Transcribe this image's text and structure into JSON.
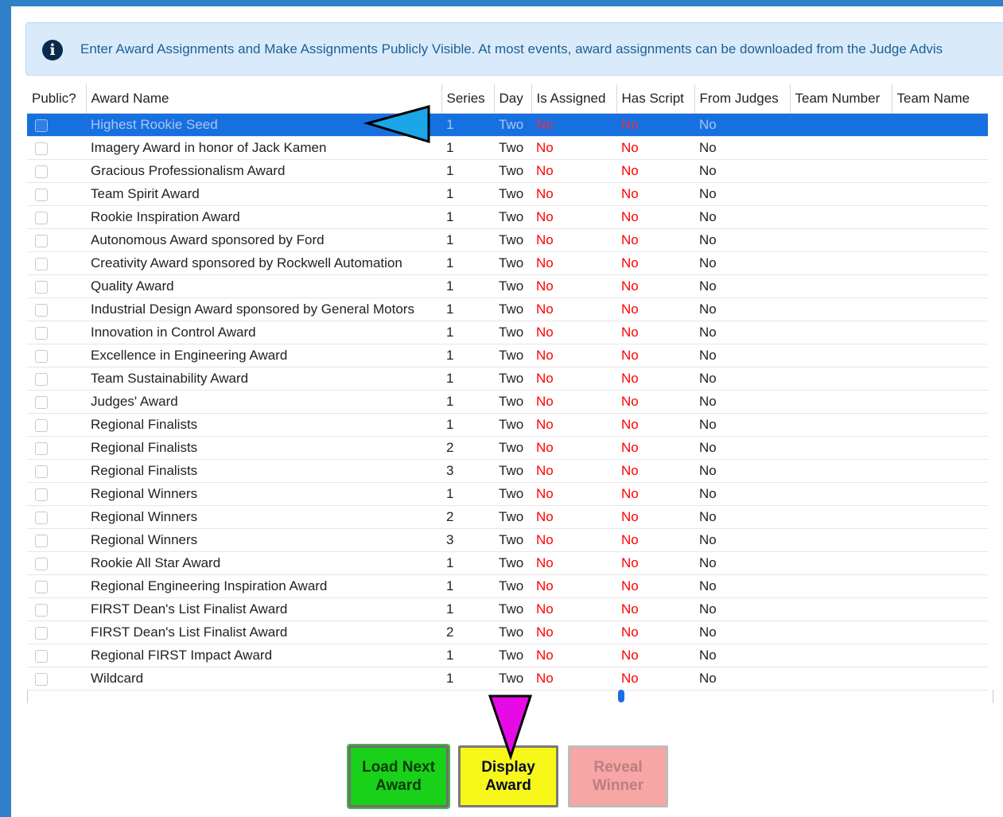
{
  "info": {
    "icon": "info-circle-icon",
    "text": "Enter Award Assignments and Make Assignments Publicly Visible. At most events, award assignments can be downloaded from the Judge Advis"
  },
  "table": {
    "headers": [
      "Public?",
      "Award Name",
      "Series",
      "Day",
      "Is Assigned",
      "Has Script",
      "From Judges",
      "Team Number",
      "Team Name"
    ],
    "rows": [
      {
        "public": false,
        "award": "Highest Rookie Seed",
        "series": "1",
        "day": "Two",
        "assigned": "No",
        "script": "No",
        "judges": "No",
        "selected": true
      },
      {
        "public": false,
        "award": "Imagery Award in honor of Jack Kamen",
        "series": "1",
        "day": "Two",
        "assigned": "No",
        "script": "No",
        "judges": "No"
      },
      {
        "public": false,
        "award": "Gracious Professionalism Award",
        "series": "1",
        "day": "Two",
        "assigned": "No",
        "script": "No",
        "judges": "No"
      },
      {
        "public": false,
        "award": "Team Spirit Award",
        "series": "1",
        "day": "Two",
        "assigned": "No",
        "script": "No",
        "judges": "No"
      },
      {
        "public": false,
        "award": "Rookie Inspiration Award",
        "series": "1",
        "day": "Two",
        "assigned": "No",
        "script": "No",
        "judges": "No"
      },
      {
        "public": false,
        "award": "Autonomous Award sponsored by Ford",
        "series": "1",
        "day": "Two",
        "assigned": "No",
        "script": "No",
        "judges": "No"
      },
      {
        "public": false,
        "award": "Creativity Award sponsored by Rockwell Automation",
        "series": "1",
        "day": "Two",
        "assigned": "No",
        "script": "No",
        "judges": "No"
      },
      {
        "public": false,
        "award": "Quality Award",
        "series": "1",
        "day": "Two",
        "assigned": "No",
        "script": "No",
        "judges": "No"
      },
      {
        "public": false,
        "award": "Industrial Design Award sponsored by General Motors",
        "series": "1",
        "day": "Two",
        "assigned": "No",
        "script": "No",
        "judges": "No"
      },
      {
        "public": false,
        "award": "Innovation in Control Award",
        "series": "1",
        "day": "Two",
        "assigned": "No",
        "script": "No",
        "judges": "No"
      },
      {
        "public": false,
        "award": "Excellence in Engineering Award",
        "series": "1",
        "day": "Two",
        "assigned": "No",
        "script": "No",
        "judges": "No"
      },
      {
        "public": false,
        "award": "Team Sustainability Award",
        "series": "1",
        "day": "Two",
        "assigned": "No",
        "script": "No",
        "judges": "No"
      },
      {
        "public": false,
        "award": "Judges' Award",
        "series": "1",
        "day": "Two",
        "assigned": "No",
        "script": "No",
        "judges": "No"
      },
      {
        "public": false,
        "award": "Regional Finalists",
        "series": "1",
        "day": "Two",
        "assigned": "No",
        "script": "No",
        "judges": "No"
      },
      {
        "public": false,
        "award": "Regional Finalists",
        "series": "2",
        "day": "Two",
        "assigned": "No",
        "script": "No",
        "judges": "No"
      },
      {
        "public": false,
        "award": "Regional Finalists",
        "series": "3",
        "day": "Two",
        "assigned": "No",
        "script": "No",
        "judges": "No"
      },
      {
        "public": false,
        "award": "Regional Winners",
        "series": "1",
        "day": "Two",
        "assigned": "No",
        "script": "No",
        "judges": "No"
      },
      {
        "public": false,
        "award": "Regional Winners",
        "series": "2",
        "day": "Two",
        "assigned": "No",
        "script": "No",
        "judges": "No"
      },
      {
        "public": false,
        "award": "Regional Winners",
        "series": "3",
        "day": "Two",
        "assigned": "No",
        "script": "No",
        "judges": "No"
      },
      {
        "public": false,
        "award": "Rookie All Star Award",
        "series": "1",
        "day": "Two",
        "assigned": "No",
        "script": "No",
        "judges": "No"
      },
      {
        "public": false,
        "award": "Regional Engineering Inspiration Award",
        "series": "1",
        "day": "Two",
        "assigned": "No",
        "script": "No",
        "judges": "No"
      },
      {
        "public": false,
        "award": "FIRST Dean's List Finalist Award",
        "series": "1",
        "day": "Two",
        "assigned": "No",
        "script": "No",
        "judges": "No"
      },
      {
        "public": false,
        "award": "FIRST Dean's List Finalist Award",
        "series": "2",
        "day": "Two",
        "assigned": "No",
        "script": "No",
        "judges": "No"
      },
      {
        "public": false,
        "award": "Regional FIRST Impact Award",
        "series": "1",
        "day": "Two",
        "assigned": "No",
        "script": "No",
        "judges": "No"
      },
      {
        "public": false,
        "award": "Wildcard",
        "series": "1",
        "day": "Two",
        "assigned": "No",
        "script": "No",
        "judges": "No"
      }
    ]
  },
  "buttons": {
    "load_next_line1": "Load Next",
    "load_next_line2": "Award",
    "display_line1": "Display",
    "display_line2": "Award",
    "reveal_line1": "Reveal",
    "reveal_line2": "Winner"
  },
  "colors": {
    "selected_row": "#1670e0",
    "negative_text": "#ff0000",
    "load_button": "#19d119",
    "display_button": "#f7f719",
    "reveal_button": "#f7a5a5",
    "pointer_blue": "#1aa6e8",
    "pointer_magenta": "#e60ae6"
  }
}
